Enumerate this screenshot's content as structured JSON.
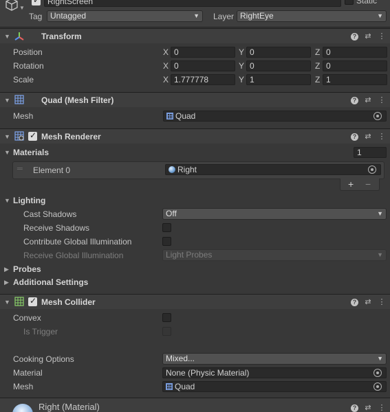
{
  "gameobject": {
    "name": "RightScreen",
    "static_label": "Static",
    "tag_label": "Tag",
    "tag_value": "Untagged",
    "layer_label": "Layer",
    "layer_value": "RightEye"
  },
  "transform": {
    "title": "Transform",
    "position_label": "Position",
    "rotation_label": "Rotation",
    "scale_label": "Scale",
    "axis_x": "X",
    "axis_y": "Y",
    "axis_z": "Z",
    "position": {
      "x": "0",
      "y": "0",
      "z": "0"
    },
    "rotation": {
      "x": "0",
      "y": "0",
      "z": "0"
    },
    "scale": {
      "x": "1.777778",
      "y": "1",
      "z": "1"
    }
  },
  "mesh_filter": {
    "title": "Quad (Mesh Filter)",
    "mesh_label": "Mesh",
    "mesh_value": "Quad"
  },
  "mesh_renderer": {
    "title": "Mesh Renderer",
    "materials_label": "Materials",
    "materials_count": "1",
    "element0_label": "Element 0",
    "element0_value": "Right",
    "add_label": "+",
    "remove_label": "−",
    "lighting_label": "Lighting",
    "cast_shadows_label": "Cast Shadows",
    "cast_shadows_value": "Off",
    "receive_shadows_label": "Receive Shadows",
    "contribute_gi_label": "Contribute Global Illumination",
    "receive_gi_label": "Receive Global Illumination",
    "receive_gi_value": "Light Probes",
    "probes_label": "Probes",
    "additional_label": "Additional Settings"
  },
  "mesh_collider": {
    "title": "Mesh Collider",
    "convex_label": "Convex",
    "is_trigger_label": "Is Trigger",
    "cooking_label": "Cooking Options",
    "cooking_value": "Mixed...",
    "material_label": "Material",
    "material_value": "None (Physic Material)",
    "mesh_label": "Mesh",
    "mesh_value": "Quad"
  },
  "material_footer": {
    "title": "Right (Material)"
  },
  "colors": {
    "background": "#383838",
    "header": "#3e3e3e",
    "field": "#2a2a2a",
    "dropdown": "#515151"
  }
}
